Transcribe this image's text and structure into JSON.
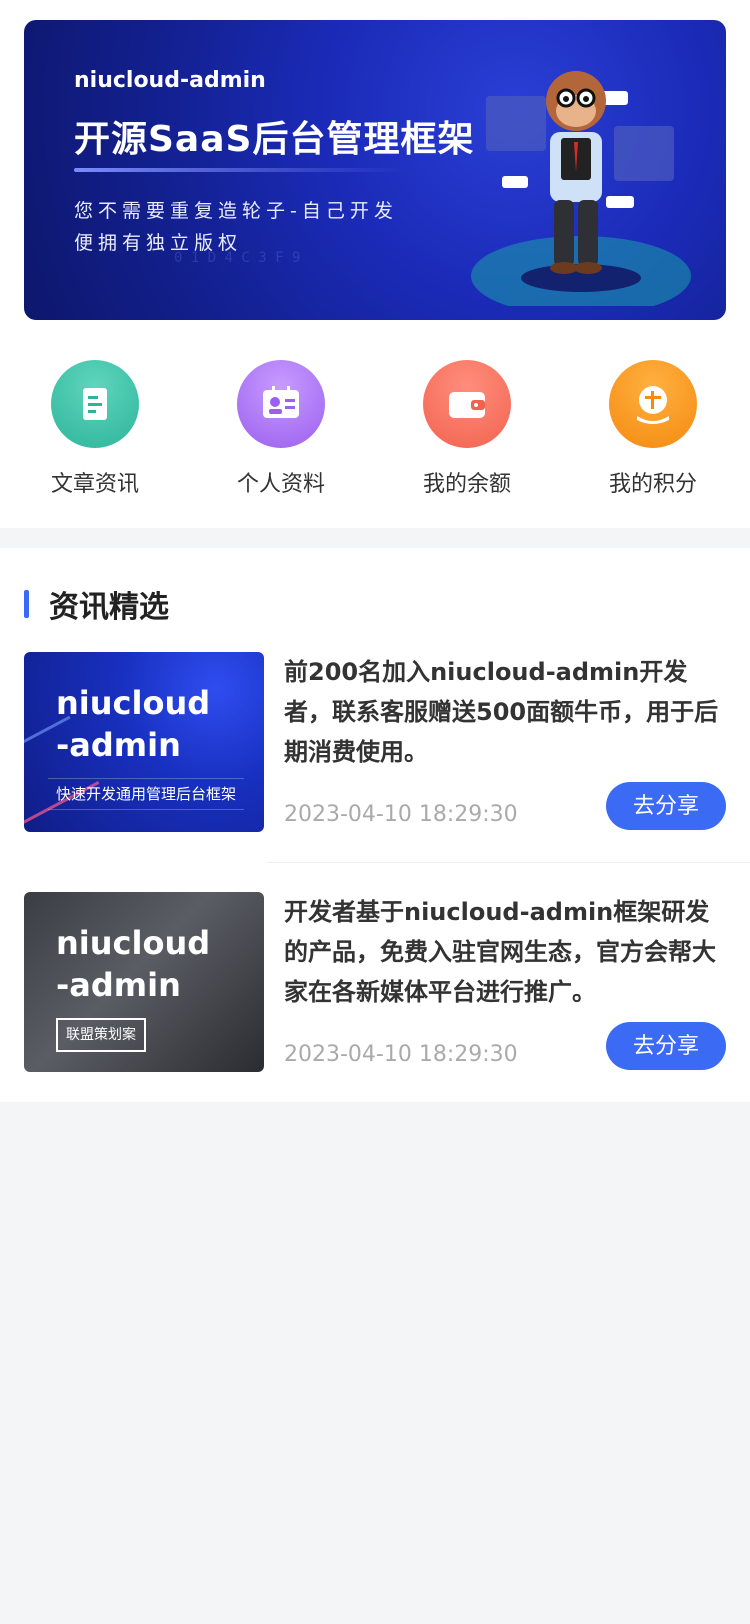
{
  "banner": {
    "brand": "niucloud-admin",
    "headline": "开源SaaS后台管理框架",
    "line1": "您不需要重复造轮子-自己开发",
    "line2": "便拥有独立版权"
  },
  "quick_nav": [
    {
      "label": "文章资讯",
      "icon": "document-icon",
      "color": "#2db59a"
    },
    {
      "label": "个人资料",
      "icon": "profile-card-icon",
      "color": "#9b60ef"
    },
    {
      "label": "我的余额",
      "icon": "wallet-icon",
      "color": "#f2634f"
    },
    {
      "label": "我的积分",
      "icon": "points-icon",
      "color": "#f48a10"
    }
  ],
  "news": {
    "title": "资讯精选",
    "articles": [
      {
        "thumb_title_1": "niucloud",
        "thumb_title_2": "-admin",
        "thumb_sub": "快速开发通用管理后台框架",
        "text": "前200名加入niucloud-admin开发者，联系客服赠送500面额牛币，用于后期消费使用。",
        "date": "2023-04-10 18:29:30",
        "share": "去分享"
      },
      {
        "thumb_title_1": "niucloud",
        "thumb_title_2": "-admin",
        "thumb_sub": "联盟策划案",
        "text": "开发者基于niucloud-admin框架研发的产品，免费入驻官网生态，官方会帮大家在各新媒体平台进行推广。",
        "date": "2023-04-10 18:29:30",
        "share": "去分享"
      }
    ]
  },
  "colors": {
    "accent": "#3b6af5",
    "background": "#f4f5f7"
  }
}
